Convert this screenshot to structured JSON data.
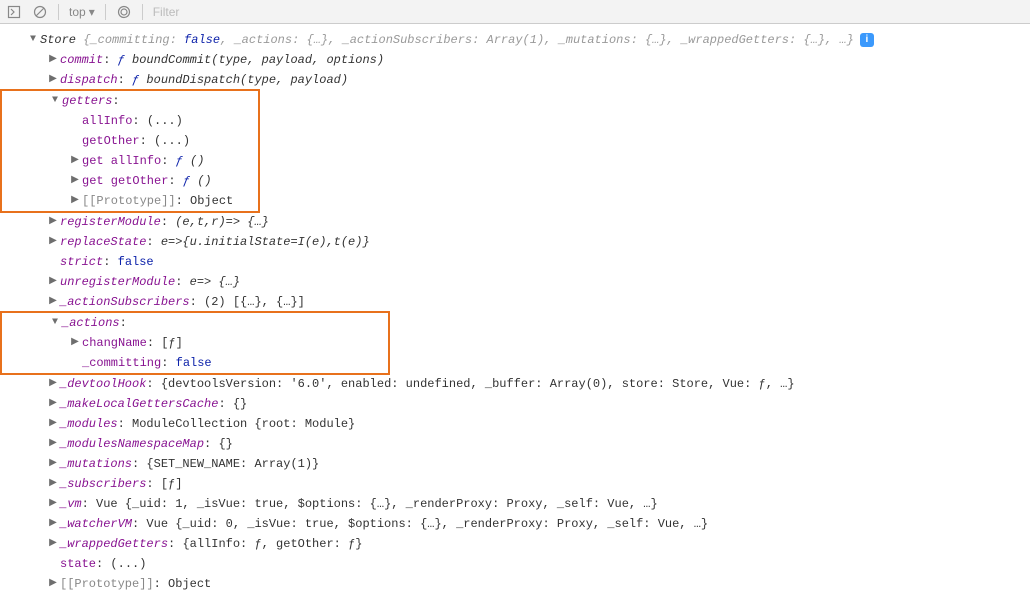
{
  "toolbar": {
    "top_label": "top",
    "filter_placeholder": "Filter"
  },
  "root": {
    "name": "Store",
    "summary_open": "{",
    "summary_k1": "_committing",
    "summary_v1": "false",
    "summary_k2": "_actions",
    "summary_v2": "{…}",
    "summary_k3": "_actionSubscribers",
    "summary_v3": "Array(1)",
    "summary_k4": "_mutations",
    "summary_v4": "{…}",
    "summary_k5": "_wrappedGetters",
    "summary_v5": "{…}",
    "summary_end": ", …}"
  },
  "lines": {
    "commit_k": "commit",
    "commit_v": "boundCommit(type, payload, options)",
    "dispatch_k": "dispatch",
    "dispatch_v": "boundDispatch(type, payload)",
    "getters_k": "getters",
    "allInfo_k": "allInfo",
    "allInfo_v": "(...)",
    "getOther_k": "getOther",
    "getOther_v": "(...)",
    "get_allInfo_k": "get allInfo",
    "get_allInfo_v": "()",
    "get_getOther_k": "get getOther",
    "get_getOther_v": "()",
    "proto_k": "[[Prototype]]",
    "proto_v": "Object",
    "registerModule_k": "registerModule",
    "registerModule_v": "(e,t,r)=> {…}",
    "replaceState_k": "replaceState",
    "replaceState_v": "e=>{u.initialState=I(e),t(e)}",
    "strict_k": "strict",
    "strict_v": "false",
    "unregisterModule_k": "unregisterModule",
    "unregisterModule_v": "e=> {…}",
    "actionSubscribers_k": "_actionSubscribers",
    "actionSubscribers_v": "(2) [{…}, {…}]",
    "actions_k": "_actions",
    "changName_k": "changName",
    "changName_v": "[ƒ]",
    "committing_k": "_committing",
    "committing_v": "false",
    "devtoolHook_k": "_devtoolHook",
    "devtoolHook_v": "{devtoolsVersion: '6.0', enabled: undefined, _buffer: Array(0), store: Store, Vue: ƒ, …}",
    "makeLocalGettersCache_k": "_makeLocalGettersCache",
    "makeLocalGettersCache_v": "{}",
    "modules_k": "_modules",
    "modules_v": "ModuleCollection {root: Module}",
    "modulesNamespaceMap_k": "_modulesNamespaceMap",
    "modulesNamespaceMap_v": "{}",
    "mutations_k": "_mutations",
    "mutations_v": "{SET_NEW_NAME: Array(1)}",
    "subscribers_k": "_subscribers",
    "subscribers_v": "[ƒ]",
    "vm_k": "_vm",
    "vm_v": "Vue {_uid: 1, _isVue: true, $options: {…}, _renderProxy: Proxy, _self: Vue, …}",
    "watcherVM_k": "_watcherVM",
    "watcherVM_v": "Vue {_uid: 0, _isVue: true, $options: {…}, _renderProxy: Proxy, _self: Vue, …}",
    "wrappedGetters_k": "_wrappedGetters",
    "wrappedGetters_v": "{allInfo: ƒ, getOther: ƒ}",
    "state_k": "state",
    "state_v": "(...)",
    "proto2_k": "[[Prototype]]",
    "proto2_v": "Object"
  }
}
